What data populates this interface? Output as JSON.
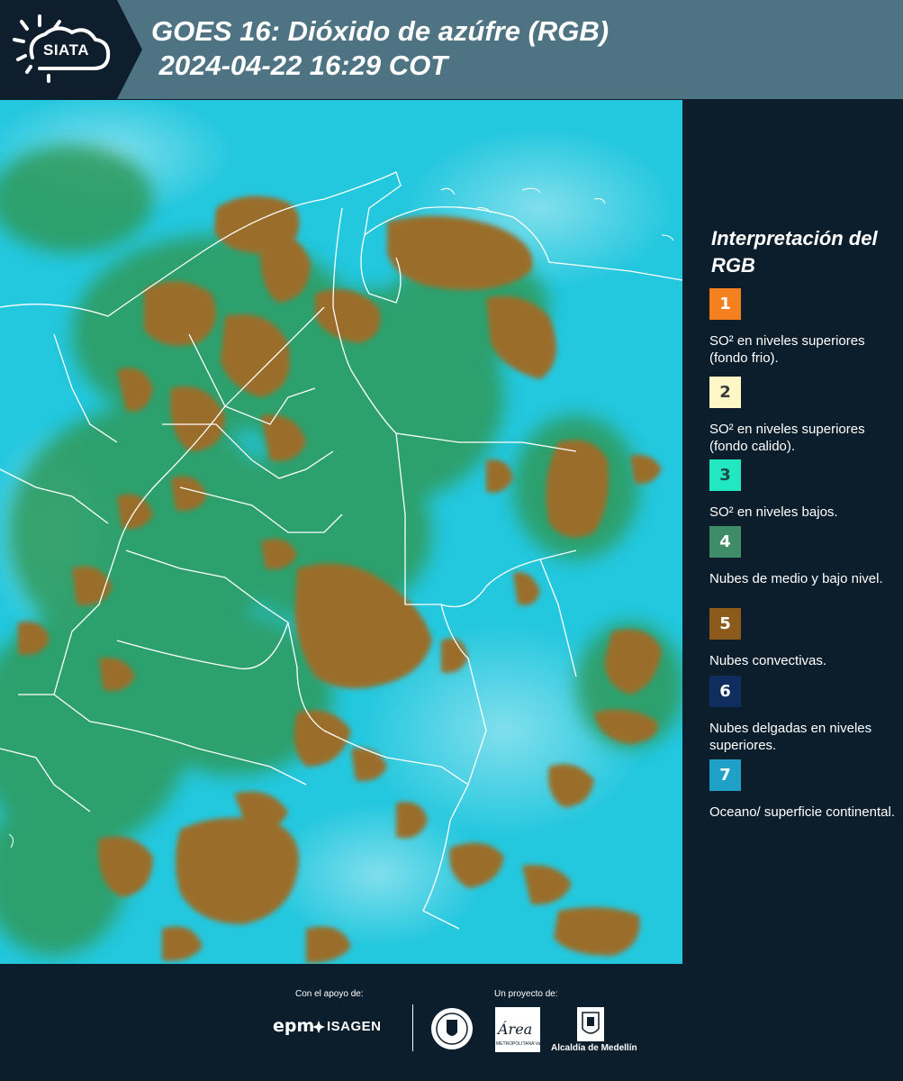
{
  "header": {
    "logo_text": "SIATA",
    "title": "GOES 16: Dióxido de azúfre (RGB)\n 2024-04-22 16:29 COT"
  },
  "legend": {
    "title": "Interpretación del RGB",
    "items": [
      {
        "number": "1",
        "color": "#f5801f",
        "text_color": "#ffffff",
        "description": "SO² en niveles superiores (fondo frio)."
      },
      {
        "number": "2",
        "color": "#fff7c6",
        "text_color": "#3a3a3a",
        "description": "SO² en niveles superiores (fondo calido)."
      },
      {
        "number": "3",
        "color": "#21e8c0",
        "text_color": "#1a4a44",
        "description": "SO² en niveles bajos."
      },
      {
        "number": "4",
        "color": "#3e8c68",
        "text_color": "#ffffff",
        "description": "Nubes de medio y bajo nivel."
      },
      {
        "number": "5",
        "color": "#8c5a1a",
        "text_color": "#ffffff",
        "description": "Nubes convectivas."
      },
      {
        "number": "6",
        "color": "#0f2d5e",
        "text_color": "#ffffff",
        "description": "Nubes delgadas en niveles superiores."
      },
      {
        "number": "7",
        "color": "#1fa0c6",
        "text_color": "#ffffff",
        "description": "Oceano/ superficie continental."
      }
    ]
  },
  "map": {
    "background_color": "#23c7de",
    "convective_color": "#9a6e2c",
    "midlevel_color": "#2f9a5a",
    "border_color": "#ffffff"
  },
  "footer": {
    "support_label": "Con el apoyo de:",
    "project_label": "Un proyecto de:",
    "epm": "epm",
    "isagen": "ISAGEN",
    "area_logo": "Área",
    "area_sub": "METROPOLITANA Valle de Aburrá",
    "alcaldia": "Alcaldía de Medellín"
  }
}
